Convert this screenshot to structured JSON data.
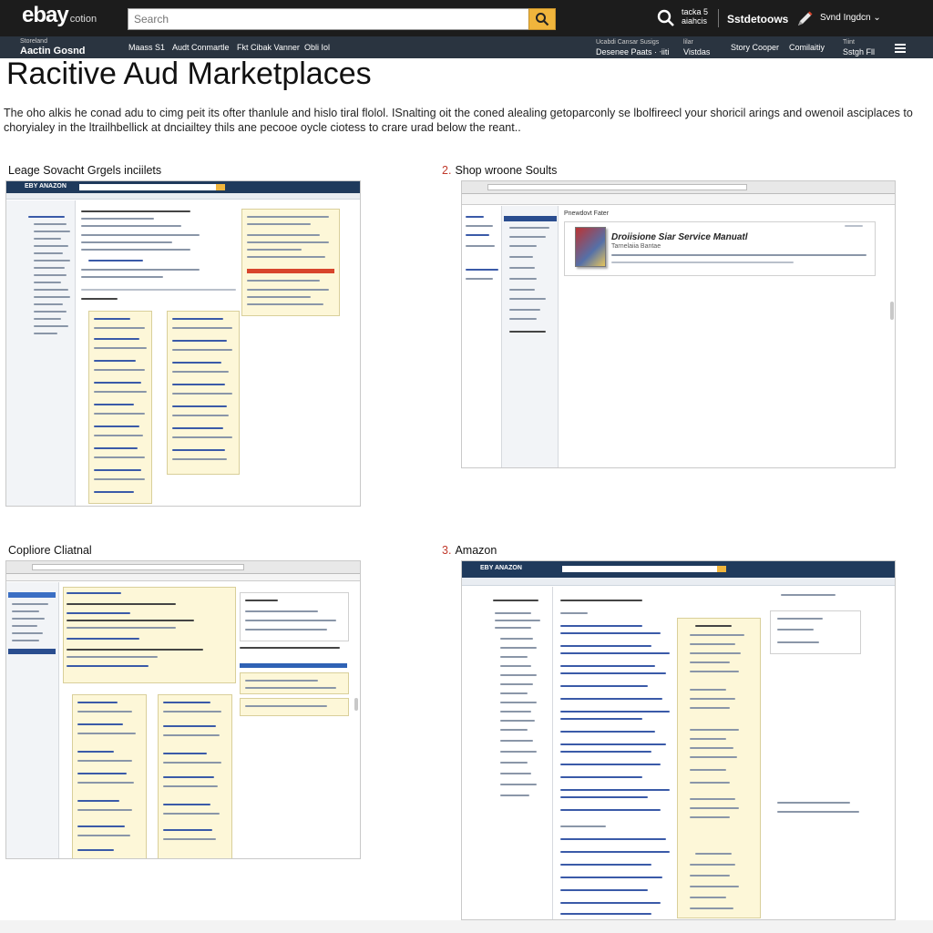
{
  "header": {
    "logo": "ebay",
    "logo_suffix": "cotion",
    "search_placeholder": "Search",
    "small_text_1": "tacka 5",
    "small_text_2": "aiahcis",
    "link_main": "Sstdetoows",
    "user_menu": "Svnd Ingdcn ⌄"
  },
  "nav": {
    "store_small": "Storeland",
    "store_main": "Aactin Gosnd",
    "items": [
      "Maass S1",
      "Audt Conmartle",
      "Fkt Cibak Vanner",
      "Obli Iol"
    ],
    "right_1_small": "Ucabdi Cansar Susigs",
    "right_1_main": "Desenee Paats · ᐧiiti",
    "right_2_small": "lilar",
    "right_2_main": "Vistdas",
    "right_3": "Story Cooper",
    "right_4": "Comilaitiy",
    "right_5_small": "Tiint",
    "right_5_main": "Sstgh Fll"
  },
  "page": {
    "title": "Racitive Aud Marketplaces",
    "intro": "The oho alkis he conad adu to cimg peit its ofter thanlule and hislo tiral flolol. ISnalting oit the coned alealing getoparconly se lbolfireecl your shoricil arings and owenoil asciplaces to choryialey in the ltrailhbellick at dnciailtey thils ane pecooe oycle ciotess to crare urad below the reant.."
  },
  "sections": [
    {
      "num": "",
      "label": "Leage Sovacht Grgels inciilets"
    },
    {
      "num": "2.",
      "label": "Shop wroone Soults"
    },
    {
      "num": "",
      "label": "Copliore Cliatnal"
    },
    {
      "num": "3.",
      "label": "Amazon"
    }
  ],
  "shots": {
    "amazon_logo": "EBY ANAZON",
    "manual_header": "Pnewdovt Fater",
    "manual_title": "Droiisione Siar Service Manuatl",
    "manual_sub": "Tarnelaiia Bantae"
  },
  "colors": {
    "header_bg": "#1c1c1c",
    "nav_bg": "#2a3440",
    "search_button": "#f0b53c",
    "accent_number": "#c0392b"
  }
}
